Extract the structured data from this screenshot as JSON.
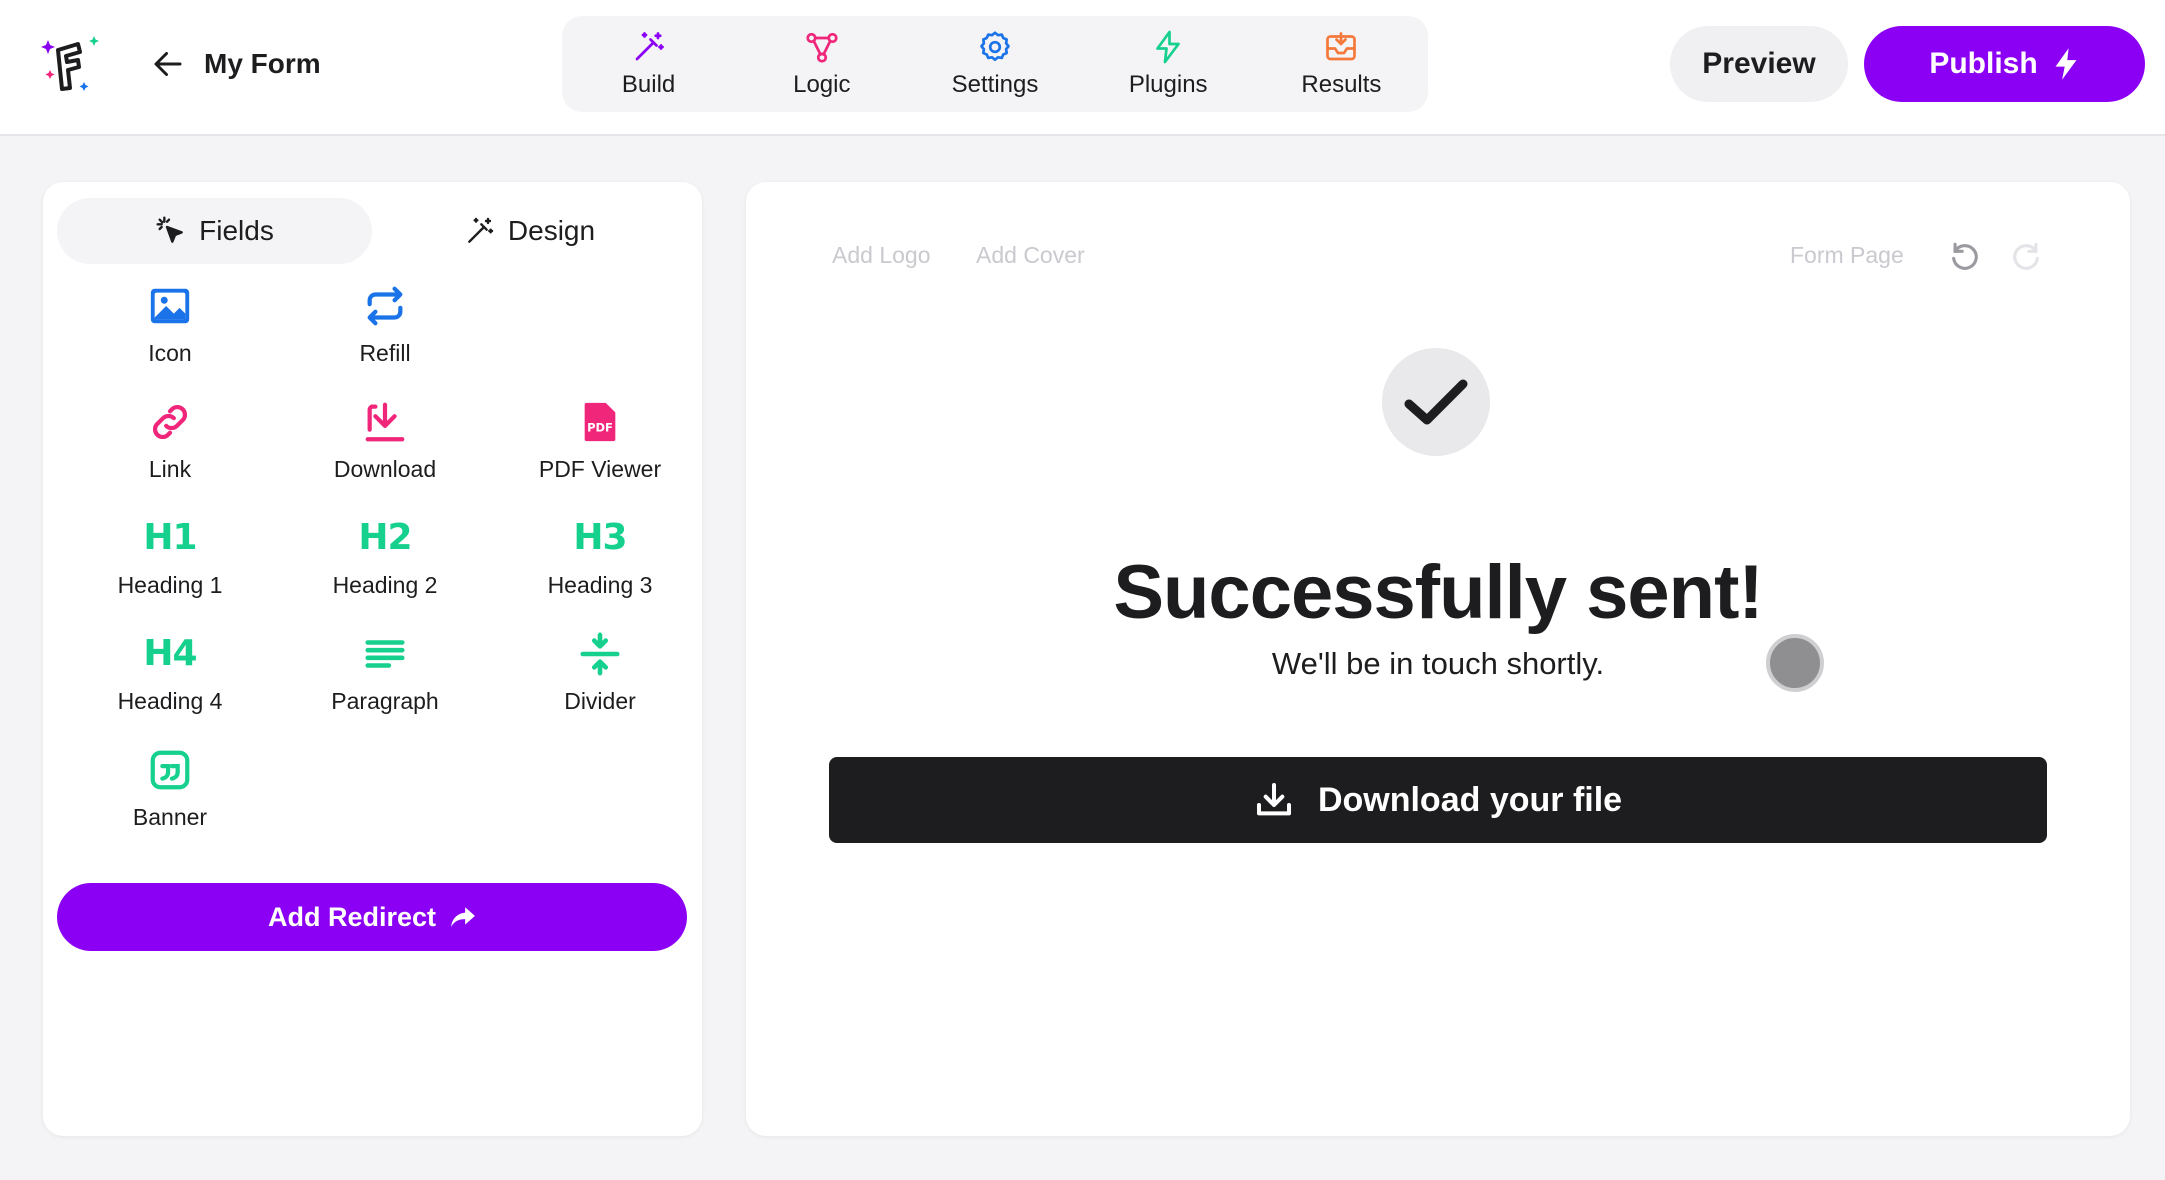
{
  "header": {
    "form_name": "My Form",
    "nav": [
      {
        "label": "Build",
        "icon": "magic-wand-icon",
        "color": "#8b00f5"
      },
      {
        "label": "Logic",
        "icon": "logic-nodes-icon",
        "color": "#f0267a"
      },
      {
        "label": "Settings",
        "icon": "gear-icon",
        "color": "#1a73e8"
      },
      {
        "label": "Plugins",
        "icon": "lightning-icon",
        "color": "#16d08e"
      },
      {
        "label": "Results",
        "icon": "inbox-icon",
        "color": "#f4793b"
      }
    ],
    "preview_label": "Preview",
    "publish_label": "Publish"
  },
  "sidebar": {
    "tabs": [
      {
        "label": "Fields",
        "icon": "pointer-click-icon",
        "active": true
      },
      {
        "label": "Design",
        "icon": "magic-wand-icon",
        "active": false
      }
    ],
    "fields": [
      {
        "label": "Icon",
        "icon": "image-icon",
        "color": "#1a73e8"
      },
      {
        "label": "Refill",
        "icon": "refresh-arrows-icon",
        "color": "#1a73e8"
      },
      {
        "label": "Link",
        "icon": "link-icon",
        "color": "#f0267a"
      },
      {
        "label": "Download",
        "icon": "download-icon",
        "color": "#f0267a"
      },
      {
        "label": "PDF Viewer",
        "icon": "pdf-file-icon",
        "color": "#f0267a"
      },
      {
        "label": "Heading 1",
        "glyph": "H1",
        "color": "#16d08e"
      },
      {
        "label": "Heading 2",
        "glyph": "H2",
        "color": "#16d08e"
      },
      {
        "label": "Heading 3",
        "glyph": "H3",
        "color": "#16d08e"
      },
      {
        "label": "Heading 4",
        "glyph": "H4",
        "color": "#16d08e"
      },
      {
        "label": "Paragraph",
        "icon": "paragraph-lines-icon",
        "color": "#16d08e"
      },
      {
        "label": "Divider",
        "icon": "divider-icon",
        "color": "#16d08e"
      },
      {
        "label": "Banner",
        "icon": "quote-banner-icon",
        "color": "#16d08e"
      }
    ],
    "redirect_label": "Add Redirect"
  },
  "main": {
    "add_logo": "Add Logo",
    "add_cover": "Add Cover",
    "form_page": "Form Page",
    "title": "Successfully sent!",
    "subtitle": "We'll be in touch shortly.",
    "download_label": "Download your file"
  },
  "colors": {
    "accent": "#8b00f5",
    "dark": "#1d1d1f",
    "background": "#f4f4f6"
  }
}
